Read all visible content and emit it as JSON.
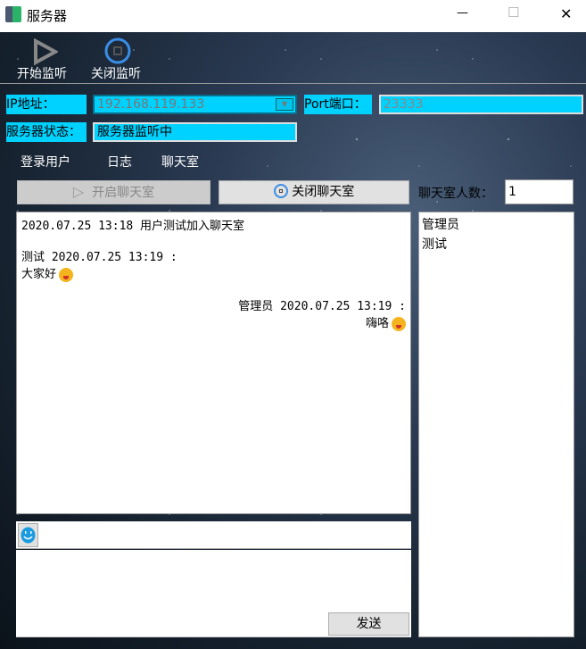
{
  "window": {
    "title": "服务器",
    "minimize": "—",
    "maximize": "☐",
    "close": "✕"
  },
  "toolbar": {
    "start_label": "开始监听",
    "stop_label": "关闭监听"
  },
  "form": {
    "ip_label": "IP地址：",
    "ip_value": "192.168.119.133",
    "port_label": "Port端口：",
    "port_value": "23333",
    "status_label": "服务器状态：",
    "status_value": "服务器监听中"
  },
  "tabs": [
    "登录用户",
    "日志",
    "聊天室"
  ],
  "chatroom": {
    "open_label": "开启聊天室",
    "close_label": "关闭聊天室",
    "count_label": "聊天室人数：",
    "count_value": "1",
    "send_label": "发送"
  },
  "messages": [
    {
      "text": "2020.07.25 13:18  用户测试加入聊天室",
      "align": "left"
    },
    {
      "text": "测试 2020.07.25 13:19 :",
      "align": "left"
    },
    {
      "text": "大家好",
      "align": "left",
      "emoji": "grinning-tongue"
    },
    {
      "text": "管理员 2020.07.25 13:19 :",
      "align": "right"
    },
    {
      "text": "嗨咯",
      "align": "right",
      "emoji": "kiss-wink"
    }
  ],
  "users": [
    "管理员",
    "测试"
  ]
}
